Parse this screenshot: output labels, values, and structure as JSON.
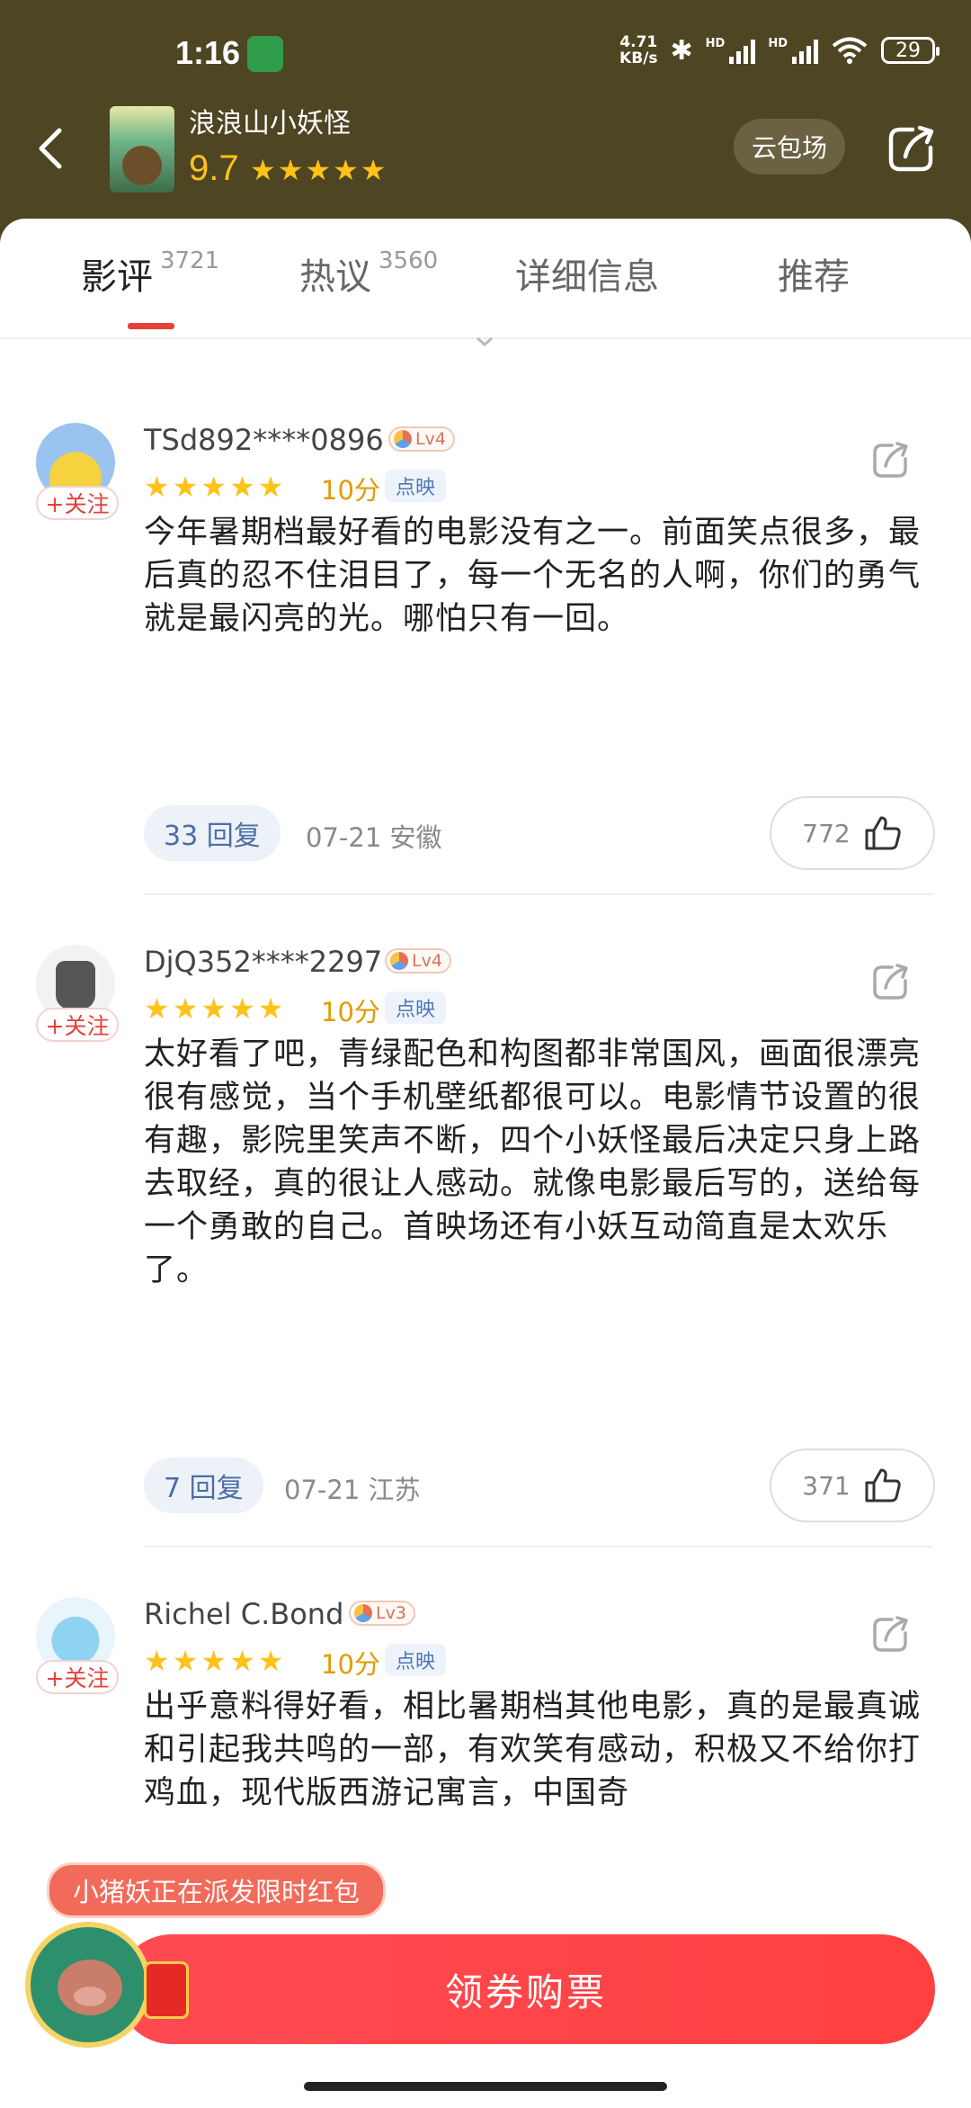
{
  "status_bar": {
    "time": "1:16",
    "net_speed_value": "4.71",
    "net_speed_unit": "KB/s",
    "bluetooth_glyph": "✱",
    "hd_label_1": "HD",
    "hd_label_2": "HD",
    "battery": "29"
  },
  "header": {
    "title": "浪浪山小妖怪",
    "score": "9.7",
    "stars": "★★★★★",
    "cloud_button": "云包场"
  },
  "tabs": [
    {
      "label": "影评",
      "count": "3721",
      "active": true
    },
    {
      "label": "热议",
      "count": "3560"
    },
    {
      "label": "详细信息"
    },
    {
      "label": "推荐"
    }
  ],
  "reviews": [
    {
      "follow": "+关注",
      "user": "TSd892****0896",
      "level": "Lv4",
      "stars": "★★★★★",
      "score": "10分",
      "source": "点映",
      "text": "今年暑期档最好看的电影没有之一。前面笑点很多，最后真的忍不住泪目了，每一个无名的人啊，你们的勇气就是最闪亮的光。哪怕只有一回。",
      "replies": "33 回复",
      "meta": "07-21 安徽",
      "likes": "772"
    },
    {
      "follow": "+关注",
      "user": "DjQ352****2297",
      "level": "Lv4",
      "stars": "★★★★★",
      "score": "10分",
      "source": "点映",
      "text": "太好看了吧，青绿配色和构图都非常国风，画面很漂亮很有感觉，当个手机壁纸都很可以。电影情节设置的很有趣，影院里笑声不断，四个小妖怪最后决定只身上路去取经，真的很让人感动。就像电影最后写的，送给每一个勇敢的自己。首映场还有小妖互动简直是太欢乐了。",
      "replies": "7 回复",
      "meta": "07-21 江苏",
      "likes": "371"
    },
    {
      "follow": "+关注",
      "user": "Richel C.Bond",
      "level": "Lv3",
      "stars": "★★★★★",
      "score": "10分",
      "source": "点映",
      "text": "出乎意料得好看，相比暑期档其他电影，真的是最真诚和引起我共鸣的一部，有欢笑有感动，积极又不给你打鸡血，现代版西游记寓言，中国奇"
    }
  ],
  "bottom": {
    "promo": "小猪妖正在派发限时红包",
    "buy_button": "领券购票"
  },
  "colors": {
    "header_bg": "#4e4522",
    "accent_red": "#e5413b",
    "star": "#ffc21a"
  }
}
